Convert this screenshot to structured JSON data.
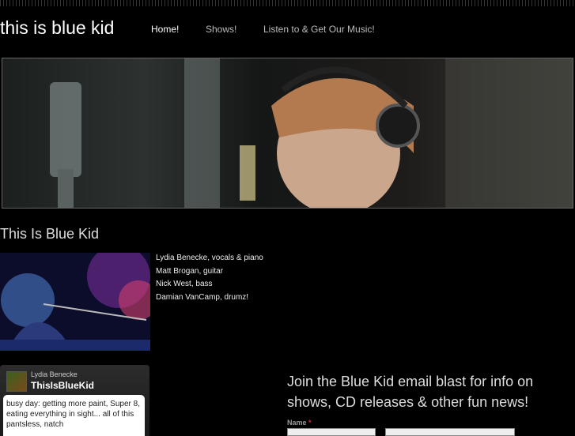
{
  "site": {
    "title": "this is blue kid"
  },
  "nav": {
    "items": [
      {
        "label": "Home!",
        "active": true
      },
      {
        "label": "Shows!",
        "active": false
      },
      {
        "label": "Listen to & Get Our Music!",
        "active": false
      }
    ]
  },
  "page": {
    "heading": "This Is Blue Kid"
  },
  "members": [
    "Lydia Benecke, vocals & piano",
    "Matt Brogan, guitar",
    "Nick West, bass",
    "Damian VanCamp, drumz!"
  ],
  "tweet": {
    "owner": "Lydia Benecke",
    "handle": "ThisIsBlueKid",
    "text": "busy day: getting more paint, Super 8, eating everything in sight... all of this pantsless, natch"
  },
  "signup": {
    "promo": "Join the Blue Kid email blast for info on shows, CD releases & other fun news!",
    "name_label": "Name",
    "required_mark": "*"
  },
  "colors": {
    "background": "#000000",
    "accent_text": "#ffffff",
    "required": "#cc3333"
  }
}
